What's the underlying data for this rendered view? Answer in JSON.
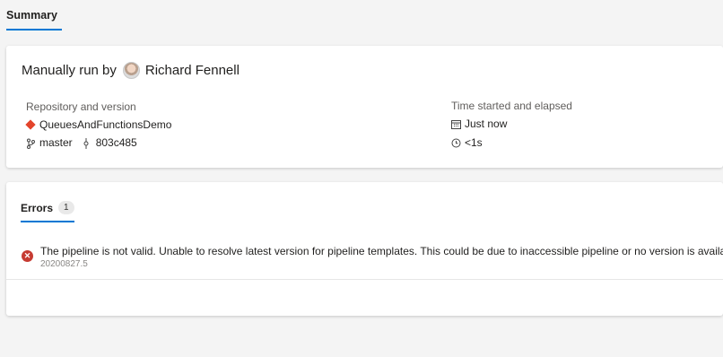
{
  "tabs": {
    "summary": "Summary"
  },
  "summary": {
    "title_prefix": "Manually run by",
    "user_name": "Richard Fennell",
    "repo_section_label": "Repository and version",
    "repo_name": "QueuesAndFunctionsDemo",
    "branch": "master",
    "commit": "803c485",
    "time_section_label": "Time started and elapsed",
    "started": "Just now",
    "elapsed": "<1s"
  },
  "errors": {
    "tab_label": "Errors",
    "count": "1",
    "items": [
      {
        "message": "The pipeline is not valid. Unable to resolve latest version for pipeline templates. This could be due to inaccessible pipeline or no version is available.",
        "run_id": "20200827.5"
      }
    ]
  },
  "colors": {
    "accent": "#0078d4",
    "error": "#c63b32",
    "repo_icon": "#e3442b"
  },
  "icons": [
    "avatar",
    "repo-icon",
    "branch-icon",
    "commit-icon",
    "calendar-icon",
    "clock-icon",
    "error-icon"
  ]
}
